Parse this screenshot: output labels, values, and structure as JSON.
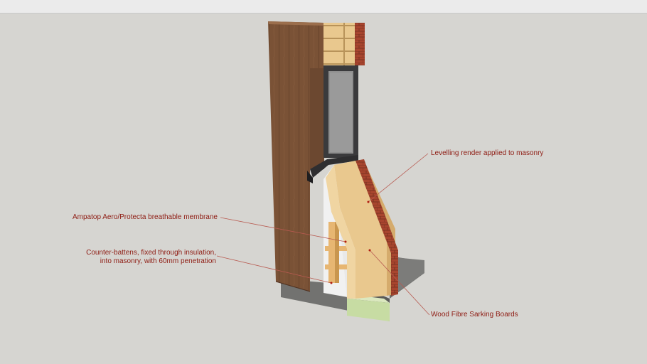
{
  "annotations": {
    "levelling_render": "Levelling render applied to masonry",
    "membrane": "Ampatop Aero/Protecta breathable membrane",
    "counter_battens_line1": "Counter-battens, fixed through insulation,",
    "counter_battens_line2": "into masonry, with 60mm penetration",
    "wood_fibre": "Wood Fibre Sarking Boards"
  },
  "colors": {
    "background": "#d6d5d1",
    "label_text": "#8e1b12",
    "leader_line": "#b85a50",
    "cladding": "#7a5236",
    "insulation": "#e9c88e",
    "brick": "#a8452e",
    "window_frame": "#3a3a3c",
    "glass": "#8f8f8f",
    "concrete": "#5a5a58",
    "membrane": "#f1f1f1"
  }
}
